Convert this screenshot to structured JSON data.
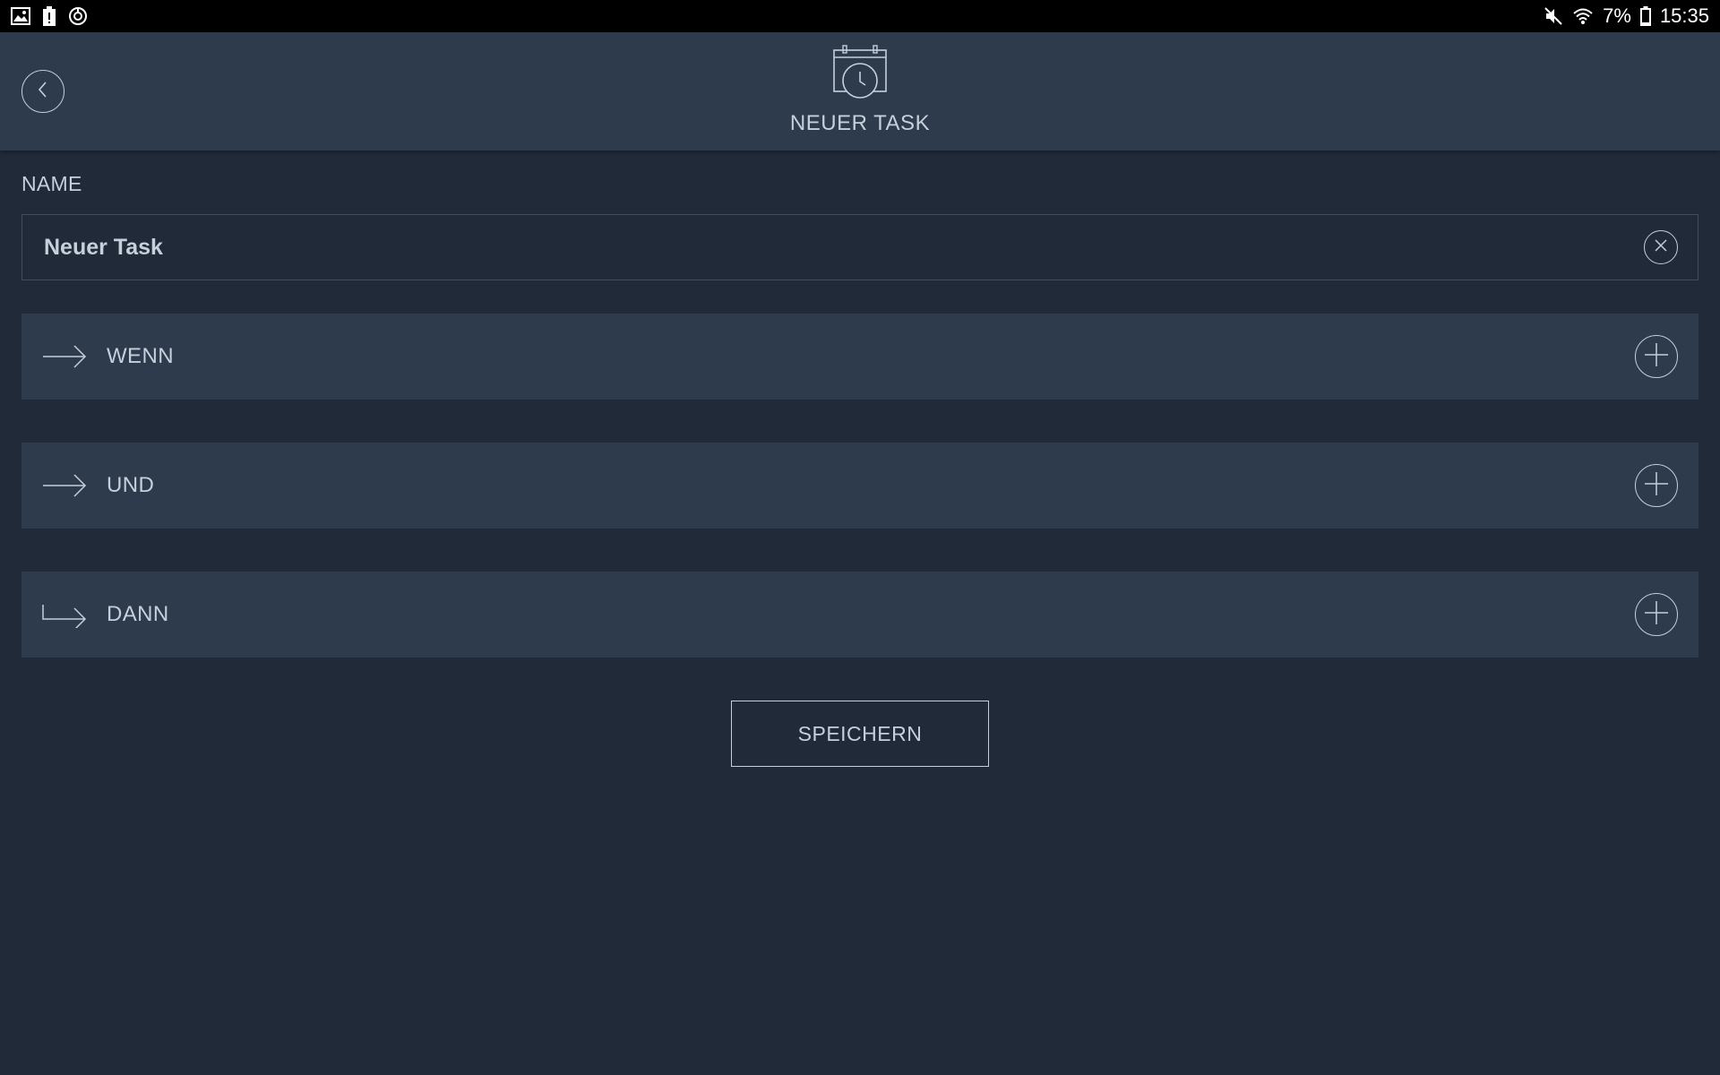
{
  "status_bar": {
    "left_icons": [
      "gallery-icon",
      "battery-alert-icon",
      "sync-icon"
    ],
    "right_icons": [
      "mute-icon",
      "wifi-icon",
      "battery-icon"
    ],
    "battery_percent": "7%",
    "time": "15:35"
  },
  "header": {
    "icon": "calendar-clock-icon",
    "title": "NEUER TASK",
    "back_icon": "chevron-left-icon"
  },
  "form": {
    "name_label": "NAME",
    "name_value": "Neuer Task",
    "clear_icon": "close-circle-icon"
  },
  "sections": [
    {
      "label": "WENN",
      "icon": "arrow-right-icon",
      "action_icon": "plus-circle-icon"
    },
    {
      "label": "UND",
      "icon": "arrow-right-icon",
      "action_icon": "plus-circle-icon"
    },
    {
      "label": "DANN",
      "icon": "arrow-return-right-icon",
      "action_icon": "plus-circle-icon"
    }
  ],
  "actions": {
    "save_label": "SPEICHERN"
  },
  "colors": {
    "background": "#212a39",
    "panel": "#2e3b4d",
    "text": "#c6cfda",
    "field_border": "#3f4c5e",
    "status_bar": "#000000"
  }
}
